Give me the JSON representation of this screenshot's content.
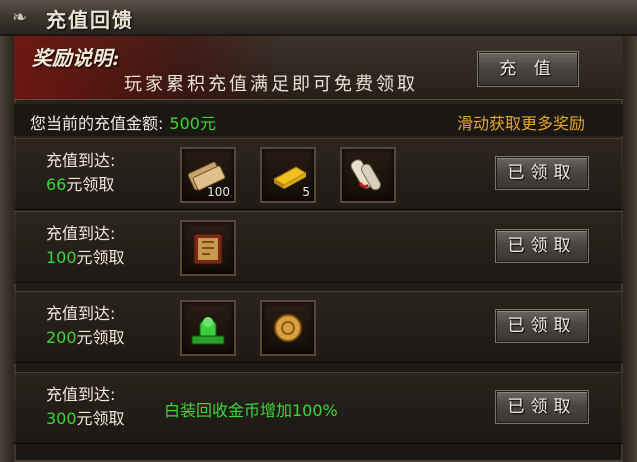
{
  "window": {
    "title": "充值回馈"
  },
  "header": {
    "reward_title": "奖励说明:",
    "reward_desc": "玩家累积充值满足即可免费领取",
    "topup_label": "充 值"
  },
  "status": {
    "amount_label": "您当前的充值金额:",
    "amount_value": "500元",
    "scroll_hint": "滑动获取更多奖励"
  },
  "tiers": [
    {
      "line1": "充值到达:",
      "amount": "66",
      "suffix": "元领取",
      "items": [
        {
          "icon": "scroll-bundle-icon",
          "qty": "100"
        },
        {
          "icon": "gold-bar-icon",
          "qty": "5"
        },
        {
          "icon": "rolled-scroll-icon",
          "qty": ""
        }
      ],
      "note": "",
      "button": "已领取"
    },
    {
      "line1": "充值到达:",
      "amount": "100",
      "suffix": "元领取",
      "items": [
        {
          "icon": "skill-book-icon",
          "qty": ""
        }
      ],
      "note": "",
      "button": "已领取"
    },
    {
      "line1": "充值到达:",
      "amount": "200",
      "suffix": "元领取",
      "items": [
        {
          "icon": "jade-statue-icon",
          "qty": ""
        },
        {
          "icon": "gold-token-icon",
          "qty": ""
        }
      ],
      "note": "",
      "button": "已领取"
    },
    {
      "line1": "充值到达:",
      "amount": "300",
      "suffix": "元领取",
      "items": [],
      "note": "白装回收金币增加100%",
      "button": "已领取"
    }
  ],
  "colors": {
    "accent_green": "#3dd63a",
    "hint_orange": "#e6a72c"
  }
}
